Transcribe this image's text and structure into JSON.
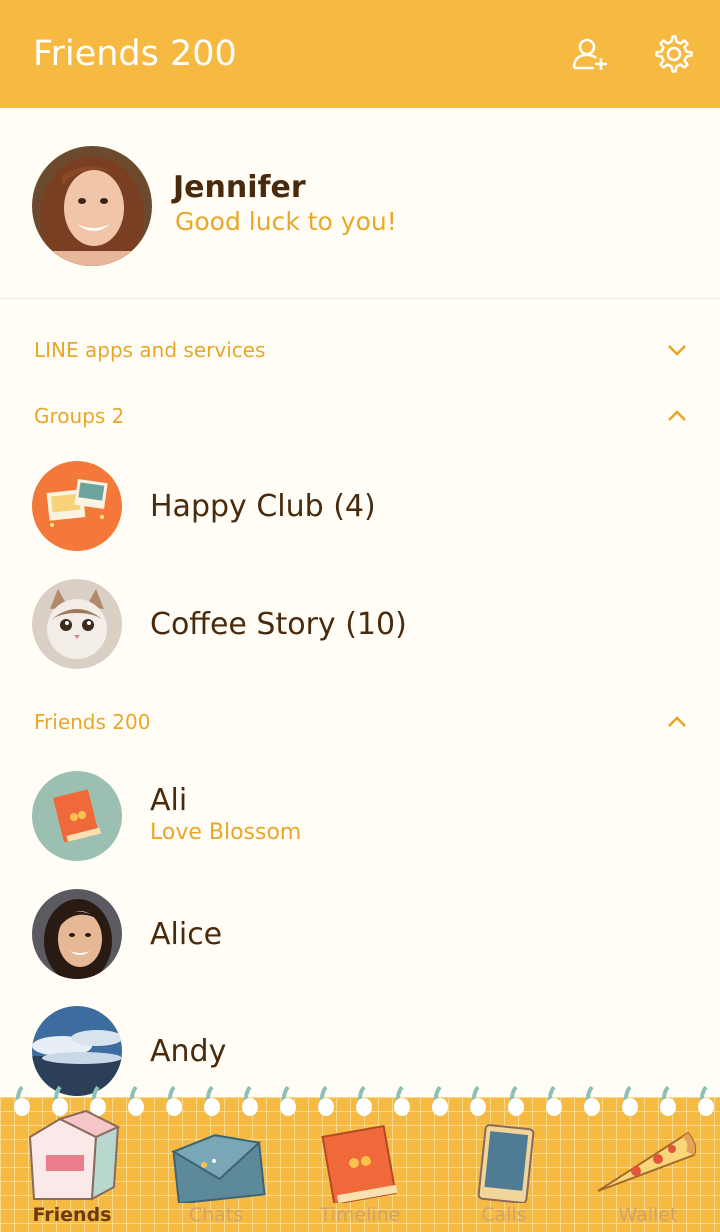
{
  "header": {
    "title": "Friends 200",
    "add_friend_icon": "add-friend-icon",
    "settings_icon": "gear-icon"
  },
  "profile": {
    "name": "Jennifer",
    "status": "Good luck to you!"
  },
  "sections": {
    "services": {
      "label": "LINE apps and services",
      "state": "collapsed"
    },
    "groups": {
      "label": "Groups 2",
      "state": "expanded"
    },
    "friends": {
      "label": "Friends 200",
      "state": "expanded"
    }
  },
  "groups": [
    {
      "name": "Happy Club (4)"
    },
    {
      "name": "Coffee Story (10)"
    }
  ],
  "friends": [
    {
      "name": "Ali",
      "status": "Love Blossom"
    },
    {
      "name": "Alice"
    },
    {
      "name": "Andy"
    }
  ],
  "tabs": [
    {
      "label": "Friends",
      "icon": "milk-carton-icon",
      "active": true
    },
    {
      "label": "Chats",
      "icon": "envelope-icon"
    },
    {
      "label": "Timeline",
      "icon": "book-icon"
    },
    {
      "label": "Calls",
      "icon": "phone-icon"
    },
    {
      "label": "Wallet",
      "icon": "pizza-icon"
    }
  ],
  "colors": {
    "accent": "#f6b941",
    "text_dark": "#4a2a0c",
    "text_accent": "#e9a72a",
    "background": "#fffdf5"
  }
}
